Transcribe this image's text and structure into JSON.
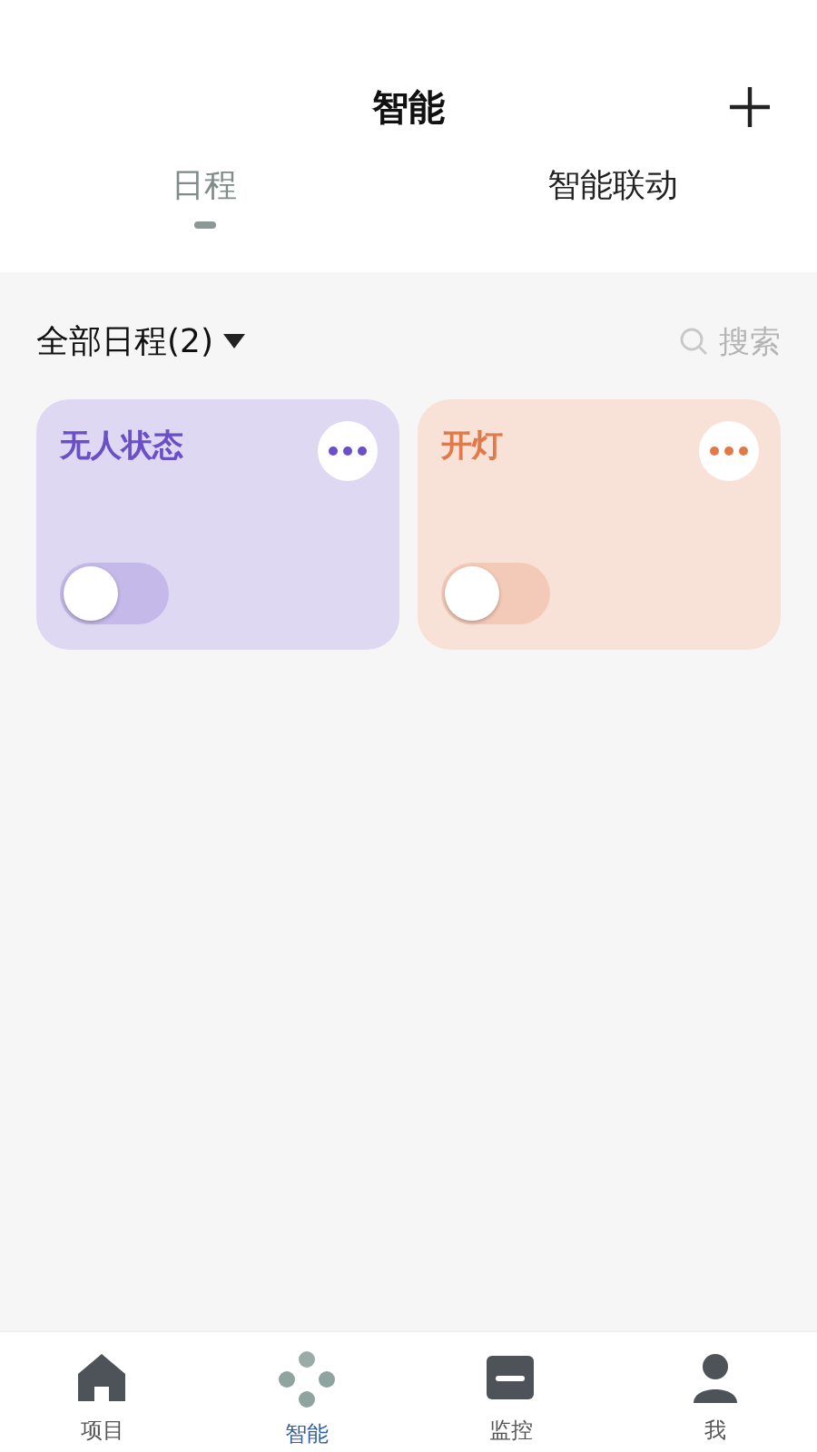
{
  "header": {
    "title": "智能"
  },
  "tabs": [
    {
      "label": "日程",
      "selected": true
    },
    {
      "label": "智能联动",
      "selected": false
    }
  ],
  "filter": {
    "label": "全部日程(2)",
    "search_placeholder": "搜索"
  },
  "scenes": [
    {
      "name": "无人状态",
      "on": false,
      "color": "#6b4fc9"
    },
    {
      "name": "开灯",
      "on": false,
      "color": "#e07a4a"
    }
  ],
  "bottom_nav": [
    {
      "label": "项目",
      "kind": "home",
      "selected": false
    },
    {
      "label": "智能",
      "kind": "smart",
      "selected": true
    },
    {
      "label": "监控",
      "kind": "monitor",
      "selected": false
    },
    {
      "label": "我",
      "kind": "me",
      "selected": false
    }
  ]
}
